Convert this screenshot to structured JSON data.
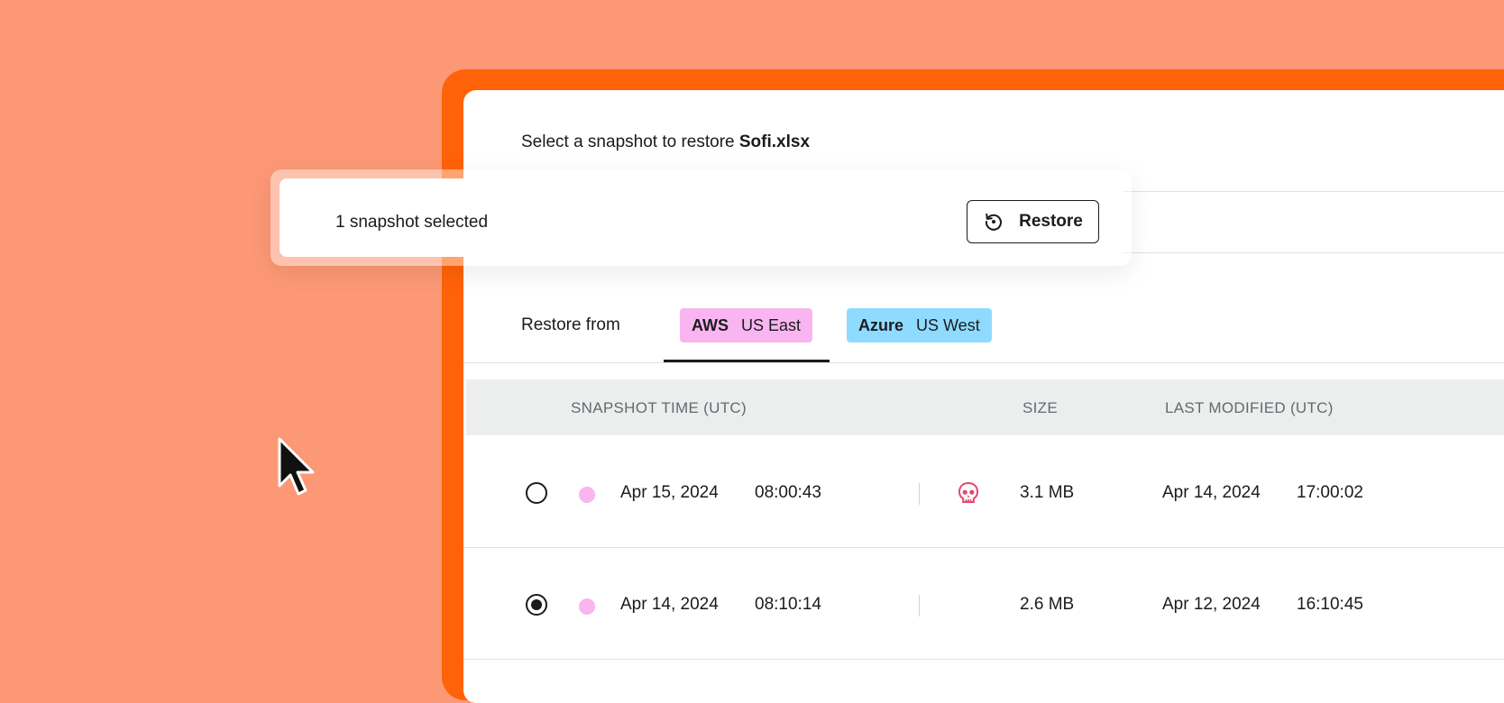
{
  "header": {
    "prefix": "Select a snapshot to restore",
    "filename": "Sofi.xlsx"
  },
  "toast": {
    "selection_text": "1 snapshot selected",
    "restore_label": "Restore"
  },
  "restore_from": {
    "label": "Restore from",
    "options": [
      {
        "provider": "AWS",
        "region": "US East",
        "color": "#f9b5f0",
        "selected": true
      },
      {
        "provider": "Azure",
        "region": "US West",
        "color": "#8fdbff",
        "selected": false
      }
    ]
  },
  "table": {
    "columns": [
      "SNAPSHOT TIME (UTC)",
      "SIZE",
      "LAST MODIFIED (UTC)"
    ],
    "rows": [
      {
        "date": "Apr 15, 2024",
        "time": "08:00:43",
        "size": "3.1 MB",
        "modified_date": "Apr 14, 2024",
        "modified_time": "17:00:02",
        "icon": "skull-icon",
        "selected": false
      },
      {
        "date": "Apr 14, 2024",
        "time": "08:10:14",
        "size": "2.6 MB",
        "modified_date": "Apr 12, 2024",
        "modified_time": "16:10:45",
        "icon": "",
        "selected": true
      }
    ]
  },
  "colors": {
    "background": "#fc9875",
    "frame": "#ff6209",
    "aws_tag": "#f9b5f0",
    "azure_tag": "#8fdbff",
    "danger": "#e5456b"
  }
}
